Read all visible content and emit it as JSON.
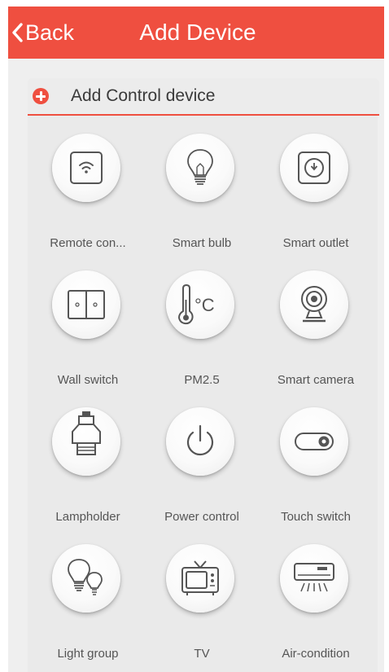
{
  "header": {
    "back_label": "Back",
    "title": "Add Device",
    "background_color": "#ef4f40"
  },
  "section": {
    "title": "Add Control device",
    "icon": "plus-circle-icon",
    "accent_color": "#ef4f40"
  },
  "devices": [
    {
      "label": "Remote con...",
      "icon": "wifi-remote-icon"
    },
    {
      "label": "Smart bulb",
      "icon": "light-bulb-icon"
    },
    {
      "label": "Smart outlet",
      "icon": "power-outlet-icon"
    },
    {
      "label": "Wall switch",
      "icon": "wall-switch-icon"
    },
    {
      "label": "PM2.5",
      "icon": "thermometer-celsius-icon",
      "icon_text": "°C"
    },
    {
      "label": "Smart camera",
      "icon": "webcam-icon"
    },
    {
      "label": "Lampholder",
      "icon": "lampholder-icon"
    },
    {
      "label": "Power control",
      "icon": "power-icon"
    },
    {
      "label": "Touch switch",
      "icon": "toggle-switch-icon"
    },
    {
      "label": "Light group",
      "icon": "light-bulbs-group-icon"
    },
    {
      "label": "TV",
      "icon": "tv-icon"
    },
    {
      "label": "Air-condition",
      "icon": "air-conditioner-icon"
    }
  ]
}
